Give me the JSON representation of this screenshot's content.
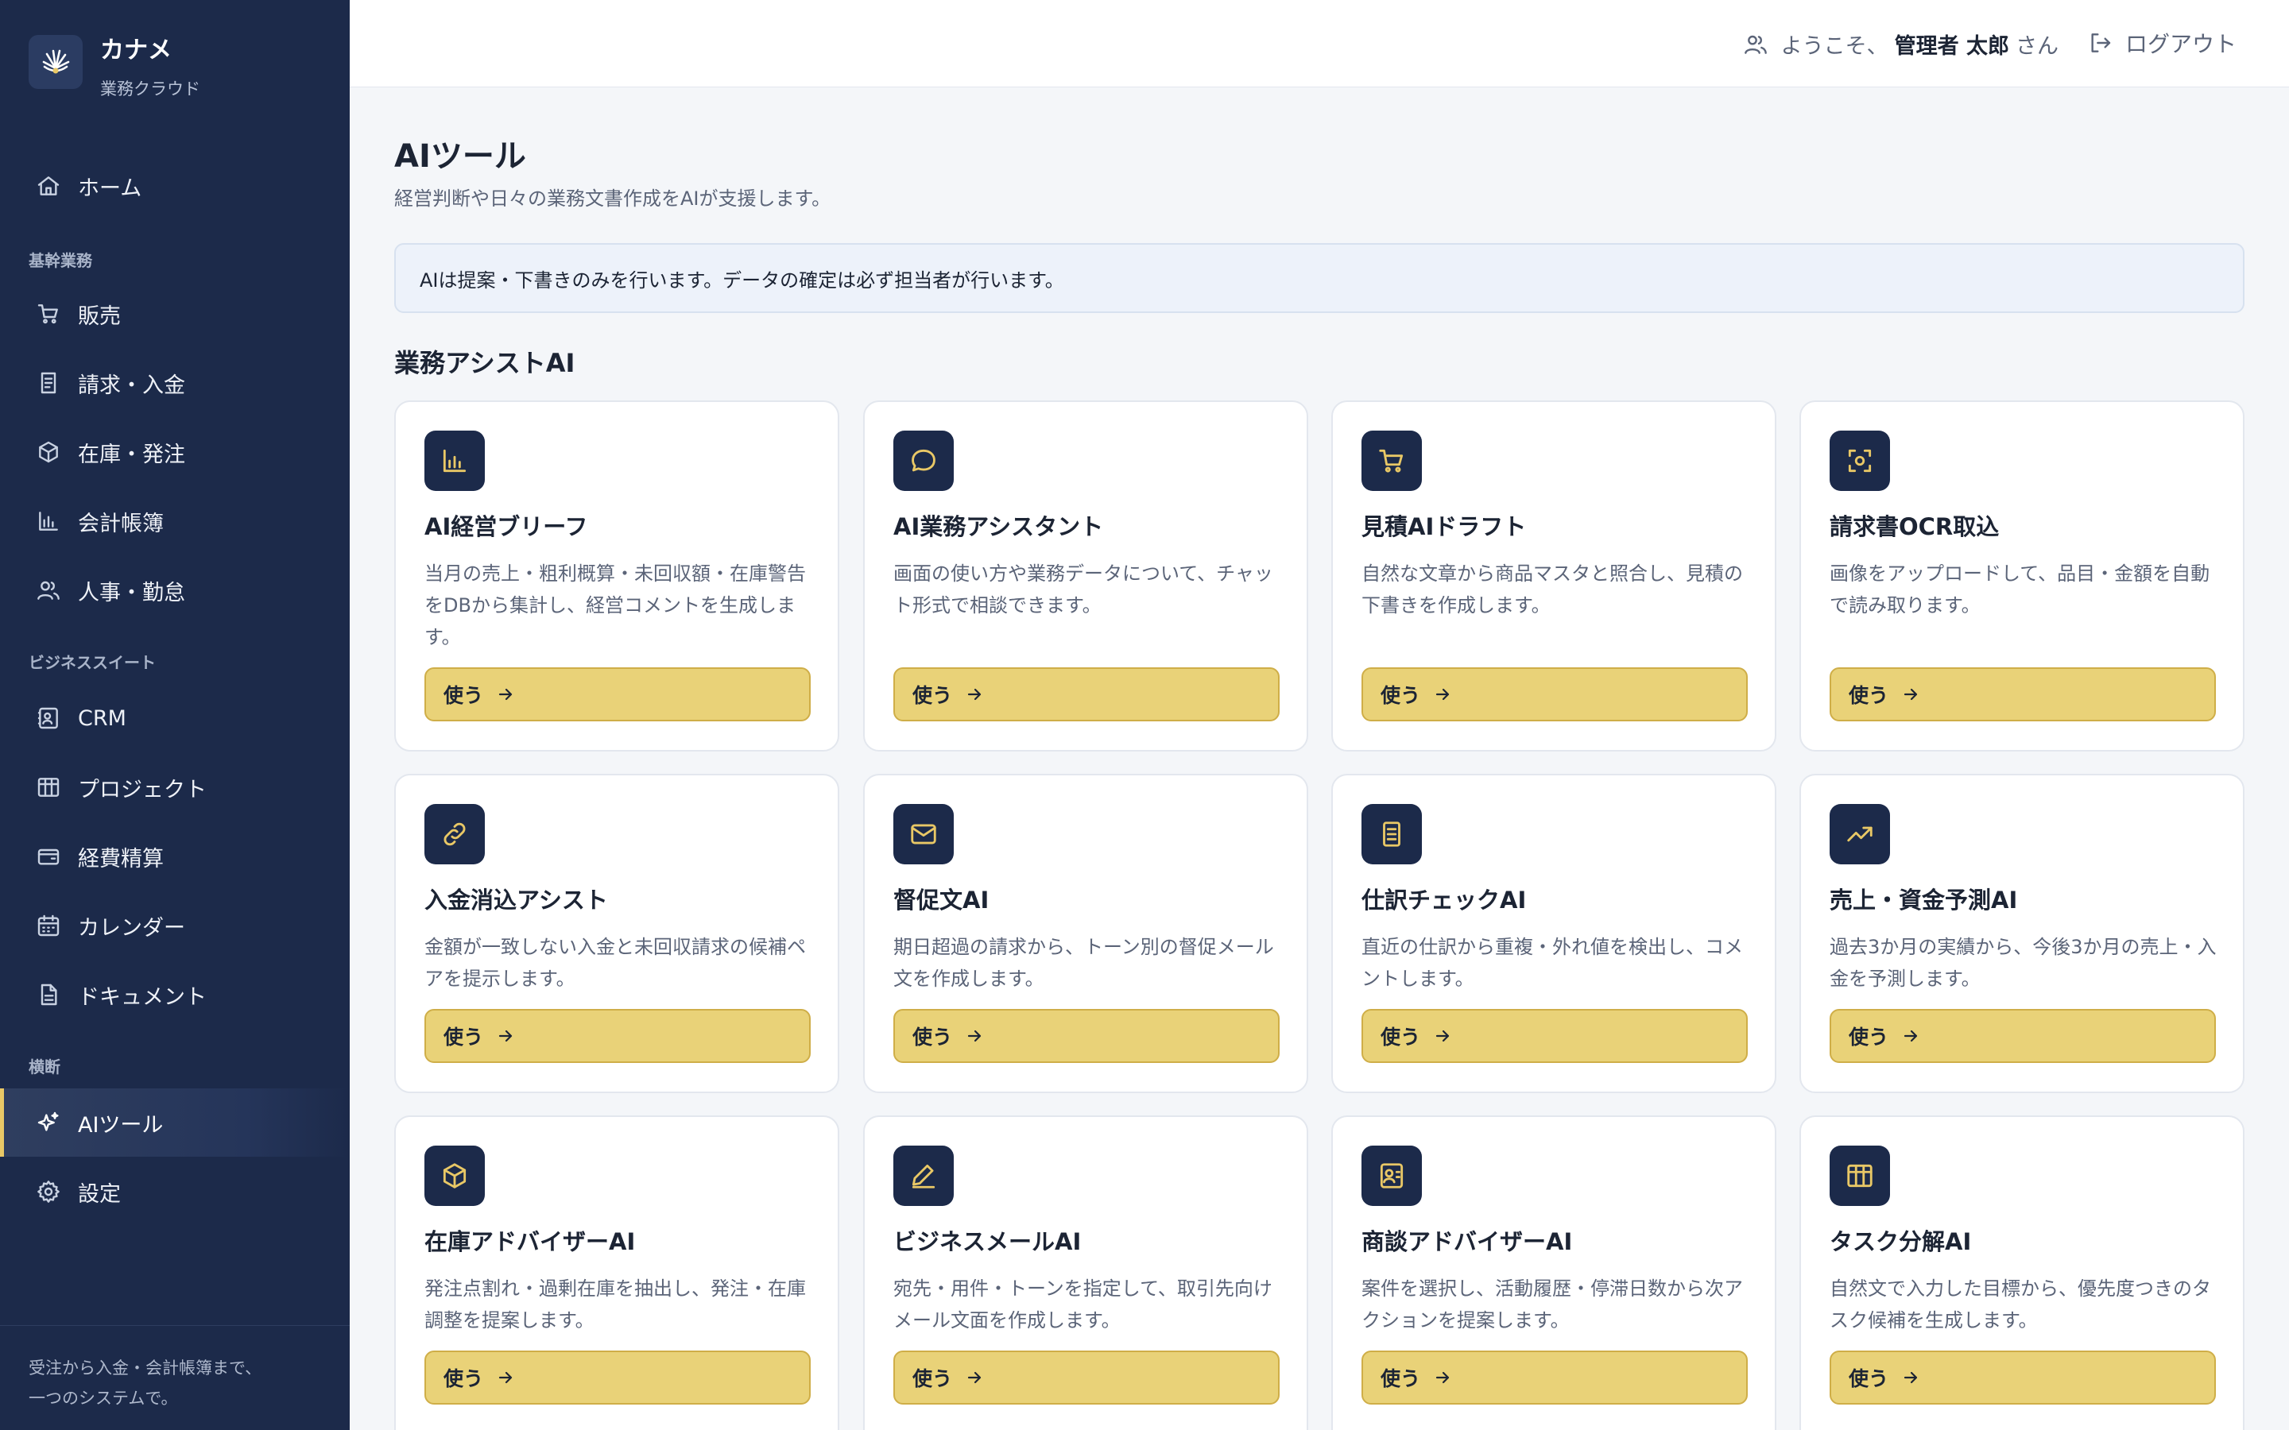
{
  "brand": {
    "name": "カナメ",
    "subtitle": "業務クラウド"
  },
  "sidebar": {
    "home": "ホーム",
    "sections": {
      "core": "基幹業務",
      "suite": "ビジネススイート",
      "cross": "横断"
    },
    "core_items": [
      "販売",
      "請求・入金",
      "在庫・発注",
      "会計帳簿",
      "人事・勤怠"
    ],
    "suite_items": [
      "CRM",
      "プロジェクト",
      "経費精算",
      "カレンダー",
      "ドキュメント"
    ],
    "cross_items": [
      "AIツール",
      "設定"
    ],
    "footer_line1": "受注から入金・会計帳簿まで、",
    "footer_line2": "一つのシステムで。",
    "active": "AIツール"
  },
  "header": {
    "welcome_prefix": "ようこそ、",
    "user_name": "管理者 太郎",
    "welcome_suffix": "さん",
    "logout": "ログアウト"
  },
  "main": {
    "title": "AIツール",
    "subtitle": "経営判断や日々の業務文書作成をAIが支援します。",
    "notice": "AIは提案・下書きのみを行います。データの確定は必ず担当者が行います。",
    "section_title": "業務アシストAI",
    "button_label": "使う",
    "cards": [
      {
        "title": "AI経営ブリーフ",
        "desc": "当月の売上・粗利概算・未回収額・在庫警告をDBから集計し、経営コメントを生成します。",
        "icon": "bar-chart-icon"
      },
      {
        "title": "AI業務アシスタント",
        "desc": "画面の使い方や業務データについて、チャット形式で相談できます。",
        "icon": "chat-bubble-icon"
      },
      {
        "title": "見積AIドラフト",
        "desc": "自然な文章から商品マスタと照合し、見積の下書きを作成します。",
        "icon": "cart-icon"
      },
      {
        "title": "請求書OCR取込",
        "desc": "画像をアップロードして、品目・金額を自動で読み取ります。",
        "icon": "scan-icon"
      },
      {
        "title": "入金消込アシスト",
        "desc": "金額が一致しない入金と未回収請求の候補ペアを提示します。",
        "icon": "link-icon"
      },
      {
        "title": "督促文AI",
        "desc": "期日超過の請求から、トーン別の督促メール文を作成します。",
        "icon": "mail-icon"
      },
      {
        "title": "仕訳チェックAI",
        "desc": "直近の仕訳から重複・外れ値を検出し、コメントします。",
        "icon": "document-icon"
      },
      {
        "title": "売上・資金予測AI",
        "desc": "過去3か月の実績から、今後3か月の売上・入金を予測します。",
        "icon": "trend-up-icon"
      },
      {
        "title": "在庫アドバイザーAI",
        "desc": "発注点割れ・過剰在庫を抽出し、発注・在庫調整を提案します。",
        "icon": "box-icon"
      },
      {
        "title": "ビジネスメールAI",
        "desc": "宛先・用件・トーンを指定して、取引先向けメール文面を作成します。",
        "icon": "pen-icon"
      },
      {
        "title": "商談アドバイザーAI",
        "desc": "案件を選択し、活動履歴・停滞日数から次アクションを提案します。",
        "icon": "contact-card-icon"
      },
      {
        "title": "タスク分解AI",
        "desc": "自然文で入力した目標から、優先度つきのタスク候補を生成します。",
        "icon": "grid-table-icon"
      }
    ]
  },
  "colors": {
    "sidebar": "#1c2a4a",
    "accent": "#e9d278",
    "accent_border": "#cfae48"
  }
}
